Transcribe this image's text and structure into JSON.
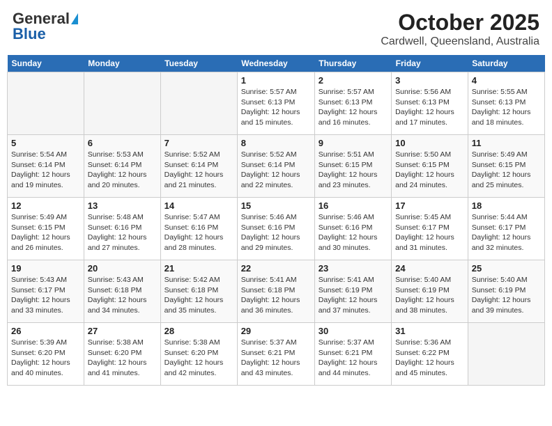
{
  "header": {
    "logo_general": "General",
    "logo_blue": "Blue",
    "month_title": "October 2025",
    "location": "Cardwell, Queensland, Australia"
  },
  "weekdays": [
    "Sunday",
    "Monday",
    "Tuesday",
    "Wednesday",
    "Thursday",
    "Friday",
    "Saturday"
  ],
  "weeks": [
    [
      {
        "day": "",
        "sunrise": "",
        "sunset": "",
        "daylight": "",
        "empty": true
      },
      {
        "day": "",
        "sunrise": "",
        "sunset": "",
        "daylight": "",
        "empty": true
      },
      {
        "day": "",
        "sunrise": "",
        "sunset": "",
        "daylight": "",
        "empty": true
      },
      {
        "day": "1",
        "sunrise": "Sunrise: 5:57 AM",
        "sunset": "Sunset: 6:13 PM",
        "daylight": "Daylight: 12 hours and 15 minutes.",
        "empty": false
      },
      {
        "day": "2",
        "sunrise": "Sunrise: 5:57 AM",
        "sunset": "Sunset: 6:13 PM",
        "daylight": "Daylight: 12 hours and 16 minutes.",
        "empty": false
      },
      {
        "day": "3",
        "sunrise": "Sunrise: 5:56 AM",
        "sunset": "Sunset: 6:13 PM",
        "daylight": "Daylight: 12 hours and 17 minutes.",
        "empty": false
      },
      {
        "day": "4",
        "sunrise": "Sunrise: 5:55 AM",
        "sunset": "Sunset: 6:13 PM",
        "daylight": "Daylight: 12 hours and 18 minutes.",
        "empty": false
      }
    ],
    [
      {
        "day": "5",
        "sunrise": "Sunrise: 5:54 AM",
        "sunset": "Sunset: 6:14 PM",
        "daylight": "Daylight: 12 hours and 19 minutes.",
        "empty": false
      },
      {
        "day": "6",
        "sunrise": "Sunrise: 5:53 AM",
        "sunset": "Sunset: 6:14 PM",
        "daylight": "Daylight: 12 hours and 20 minutes.",
        "empty": false
      },
      {
        "day": "7",
        "sunrise": "Sunrise: 5:52 AM",
        "sunset": "Sunset: 6:14 PM",
        "daylight": "Daylight: 12 hours and 21 minutes.",
        "empty": false
      },
      {
        "day": "8",
        "sunrise": "Sunrise: 5:52 AM",
        "sunset": "Sunset: 6:14 PM",
        "daylight": "Daylight: 12 hours and 22 minutes.",
        "empty": false
      },
      {
        "day": "9",
        "sunrise": "Sunrise: 5:51 AM",
        "sunset": "Sunset: 6:15 PM",
        "daylight": "Daylight: 12 hours and 23 minutes.",
        "empty": false
      },
      {
        "day": "10",
        "sunrise": "Sunrise: 5:50 AM",
        "sunset": "Sunset: 6:15 PM",
        "daylight": "Daylight: 12 hours and 24 minutes.",
        "empty": false
      },
      {
        "day": "11",
        "sunrise": "Sunrise: 5:49 AM",
        "sunset": "Sunset: 6:15 PM",
        "daylight": "Daylight: 12 hours and 25 minutes.",
        "empty": false
      }
    ],
    [
      {
        "day": "12",
        "sunrise": "Sunrise: 5:49 AM",
        "sunset": "Sunset: 6:15 PM",
        "daylight": "Daylight: 12 hours and 26 minutes.",
        "empty": false
      },
      {
        "day": "13",
        "sunrise": "Sunrise: 5:48 AM",
        "sunset": "Sunset: 6:16 PM",
        "daylight": "Daylight: 12 hours and 27 minutes.",
        "empty": false
      },
      {
        "day": "14",
        "sunrise": "Sunrise: 5:47 AM",
        "sunset": "Sunset: 6:16 PM",
        "daylight": "Daylight: 12 hours and 28 minutes.",
        "empty": false
      },
      {
        "day": "15",
        "sunrise": "Sunrise: 5:46 AM",
        "sunset": "Sunset: 6:16 PM",
        "daylight": "Daylight: 12 hours and 29 minutes.",
        "empty": false
      },
      {
        "day": "16",
        "sunrise": "Sunrise: 5:46 AM",
        "sunset": "Sunset: 6:16 PM",
        "daylight": "Daylight: 12 hours and 30 minutes.",
        "empty": false
      },
      {
        "day": "17",
        "sunrise": "Sunrise: 5:45 AM",
        "sunset": "Sunset: 6:17 PM",
        "daylight": "Daylight: 12 hours and 31 minutes.",
        "empty": false
      },
      {
        "day": "18",
        "sunrise": "Sunrise: 5:44 AM",
        "sunset": "Sunset: 6:17 PM",
        "daylight": "Daylight: 12 hours and 32 minutes.",
        "empty": false
      }
    ],
    [
      {
        "day": "19",
        "sunrise": "Sunrise: 5:43 AM",
        "sunset": "Sunset: 6:17 PM",
        "daylight": "Daylight: 12 hours and 33 minutes.",
        "empty": false
      },
      {
        "day": "20",
        "sunrise": "Sunrise: 5:43 AM",
        "sunset": "Sunset: 6:18 PM",
        "daylight": "Daylight: 12 hours and 34 minutes.",
        "empty": false
      },
      {
        "day": "21",
        "sunrise": "Sunrise: 5:42 AM",
        "sunset": "Sunset: 6:18 PM",
        "daylight": "Daylight: 12 hours and 35 minutes.",
        "empty": false
      },
      {
        "day": "22",
        "sunrise": "Sunrise: 5:41 AM",
        "sunset": "Sunset: 6:18 PM",
        "daylight": "Daylight: 12 hours and 36 minutes.",
        "empty": false
      },
      {
        "day": "23",
        "sunrise": "Sunrise: 5:41 AM",
        "sunset": "Sunset: 6:19 PM",
        "daylight": "Daylight: 12 hours and 37 minutes.",
        "empty": false
      },
      {
        "day": "24",
        "sunrise": "Sunrise: 5:40 AM",
        "sunset": "Sunset: 6:19 PM",
        "daylight": "Daylight: 12 hours and 38 minutes.",
        "empty": false
      },
      {
        "day": "25",
        "sunrise": "Sunrise: 5:40 AM",
        "sunset": "Sunset: 6:19 PM",
        "daylight": "Daylight: 12 hours and 39 minutes.",
        "empty": false
      }
    ],
    [
      {
        "day": "26",
        "sunrise": "Sunrise: 5:39 AM",
        "sunset": "Sunset: 6:20 PM",
        "daylight": "Daylight: 12 hours and 40 minutes.",
        "empty": false
      },
      {
        "day": "27",
        "sunrise": "Sunrise: 5:38 AM",
        "sunset": "Sunset: 6:20 PM",
        "daylight": "Daylight: 12 hours and 41 minutes.",
        "empty": false
      },
      {
        "day": "28",
        "sunrise": "Sunrise: 5:38 AM",
        "sunset": "Sunset: 6:20 PM",
        "daylight": "Daylight: 12 hours and 42 minutes.",
        "empty": false
      },
      {
        "day": "29",
        "sunrise": "Sunrise: 5:37 AM",
        "sunset": "Sunset: 6:21 PM",
        "daylight": "Daylight: 12 hours and 43 minutes.",
        "empty": false
      },
      {
        "day": "30",
        "sunrise": "Sunrise: 5:37 AM",
        "sunset": "Sunset: 6:21 PM",
        "daylight": "Daylight: 12 hours and 44 minutes.",
        "empty": false
      },
      {
        "day": "31",
        "sunrise": "Sunrise: 5:36 AM",
        "sunset": "Sunset: 6:22 PM",
        "daylight": "Daylight: 12 hours and 45 minutes.",
        "empty": false
      },
      {
        "day": "",
        "sunrise": "",
        "sunset": "",
        "daylight": "",
        "empty": true
      }
    ]
  ]
}
